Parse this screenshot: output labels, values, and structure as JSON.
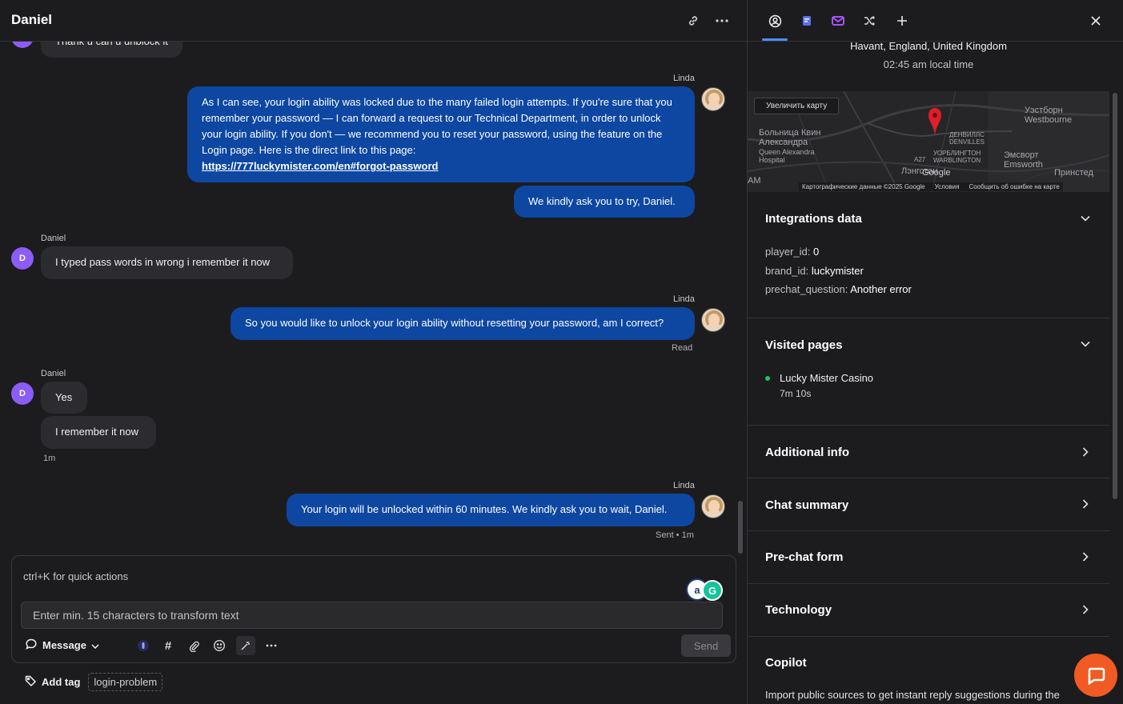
{
  "header": {
    "title": "Daniel"
  },
  "messages": {
    "partial_top": "Thank u can u unblock it",
    "agent1_sender": "Linda",
    "agent1_text": "As I can see, your login ability was locked due to the many failed login attempts. If you're sure that you remember your password — I can forward a request to our Technical Department, in order to unlock your login ability. If you don't — we recommend you to reset your password, using the feature on the Login page. Here is the direct link to this page:",
    "agent1_link": "https://777luckymister.com/en#forgot-password",
    "agent2_text": "We kindly ask you to try, Daniel.",
    "user1_sender": "Daniel",
    "user1_text": "I typed pass words in wrong i remember it now",
    "agent3_sender": "Linda",
    "agent3_text": "So you would like to unlock your login ability without resetting your password, am I correct?",
    "agent3_status": "Read",
    "user2_sender": "Daniel",
    "user2_text1": "Yes",
    "user2_text2": "I remember it now",
    "user2_time": "1m",
    "agent4_sender": "Linda",
    "agent4_text": "Your login will be unlocked within 60 minutes. We kindly ask you to wait, Daniel.",
    "agent4_status": "Sent • 1m",
    "user_avatar_letter": "D"
  },
  "composer": {
    "quick_actions": "ctrl+K for quick actions",
    "transform_placeholder": "Enter min. 15 characters to transform text",
    "message_mode": "Message",
    "send_label": "Send",
    "ext_a_letter": "a",
    "ext_b_letter": "G"
  },
  "tags": {
    "add_label": "Add tag",
    "items": [
      "login-problem"
    ]
  },
  "details": {
    "location": "Havant, England, United Kingdom",
    "local_time": "02:45 am local time",
    "map": {
      "enlarge": "Увеличить карту",
      "label_hospital_ru": "Больница Квин Александра",
      "label_hospital_en": "Queen Alexandra Hospital",
      "label_westbourne": "Уэстборн Westbourne",
      "label_denvilles": "ДЕНВИЛЛС DENVILLES",
      "label_warblington": "УОРБЛИНГТОН WARBLINGTON",
      "label_emsworth": "Эмсворт Emsworth",
      "label_prinsted": "Принстед",
      "label_langstone": "Лэнгстон",
      "label_road": "A27",
      "label_am": "AM",
      "label_google": "Google",
      "footer_data": "Картографические данные ©2025 Google",
      "footer_terms": "Условия",
      "footer_report": "Сообщить об ошибке на карте"
    },
    "integrations": {
      "title": "Integrations data",
      "player_id_key": "player_id:",
      "player_id_val": "0",
      "brand_id_key": "brand_id:",
      "brand_id_val": "luckymister",
      "prechat_key": "prechat_question:",
      "prechat_val": "Another error"
    },
    "visited": {
      "title": "Visited pages",
      "page_title": "Lucky Mister Casino",
      "page_time": "7m 10s"
    },
    "additional_info": "Additional info",
    "chat_summary": "Chat summary",
    "prechat_form": "Pre-chat form",
    "technology": "Technology",
    "copilot": {
      "title": "Copilot",
      "text": "Import public sources to get instant reply suggestions during the"
    }
  },
  "colors": {
    "agent_bubble": "#0d47a1",
    "user_avatar": "#8b5cf6",
    "fab": "#f15a22",
    "tab_active": "#4f8df7",
    "online_dot": "#22c55e"
  }
}
